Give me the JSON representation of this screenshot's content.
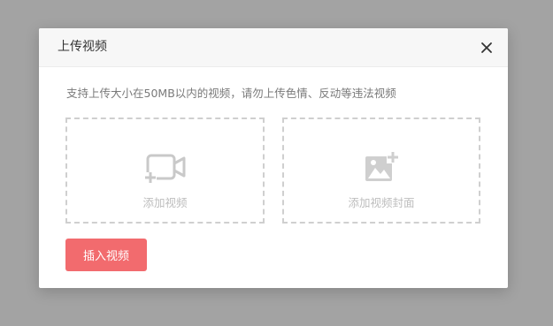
{
  "dialog": {
    "title": "上传视频",
    "notice": "支持上传大小在50MB以内的视频，请勿上传色情、反动等违法视频",
    "upload_video": {
      "label": "添加视频",
      "icon": "video-camera-add-icon"
    },
    "upload_cover": {
      "label": "添加视频封面",
      "icon": "image-add-icon"
    },
    "insert_button": "插入视频",
    "close_icon": "close-icon"
  },
  "colors": {
    "overlay": "#a3a3a3",
    "header_bg": "#f7f7f7",
    "accent": "#f26b6e",
    "placeholder": "#bdbdbd",
    "dashed_border": "#cfcfcf"
  }
}
